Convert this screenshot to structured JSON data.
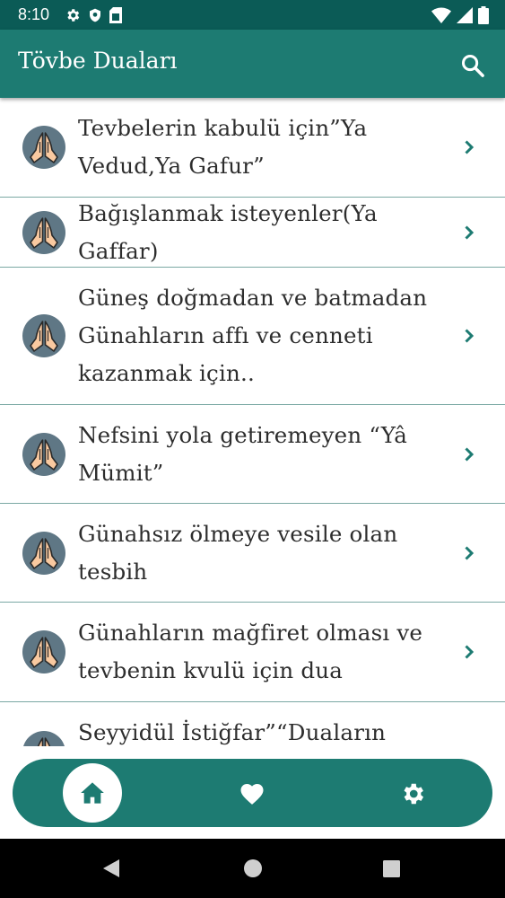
{
  "status_bar": {
    "time": "8:10",
    "icons": [
      "gear-icon",
      "shield-icon",
      "sim-card-icon",
      "wifi-icon",
      "signal-icon",
      "battery-icon"
    ]
  },
  "app_bar": {
    "title": "Tövbe Duaları",
    "search_icon": "search-icon"
  },
  "list": {
    "items": [
      {
        "title": "Tevbelerin kabulü için”Ya Vedud,Ya Gafur”"
      },
      {
        "title": "Bağışlanmak isteyenler(Ya Gaffar)"
      },
      {
        "title": "Güneş doğmadan ve batmadan Günahların affı ve cenneti kazanmak için.."
      },
      {
        "title": "Nefsini yola getiremeyen “Yâ Mümit”"
      },
      {
        "title": "Günahsız ölmeye vesile olan tesbih"
      },
      {
        "title": "Günahların mağfiret olması ve tevbenin kvulü için dua"
      },
      {
        "title": "Seyyidül İstiğfar”“Duaların"
      }
    ]
  },
  "bottom_nav": {
    "items": [
      "home-icon",
      "heart-icon",
      "settings-icon"
    ],
    "active": "home-icon"
  },
  "system_nav": {
    "items": [
      "back-icon",
      "home-circle-icon",
      "recents-icon"
    ]
  },
  "colors": {
    "primary": "#1d7b72",
    "primary_dark": "#0b5b56",
    "divider": "#7ba9a4",
    "chevron": "#1d7b72",
    "text": "#2d2d2d"
  }
}
